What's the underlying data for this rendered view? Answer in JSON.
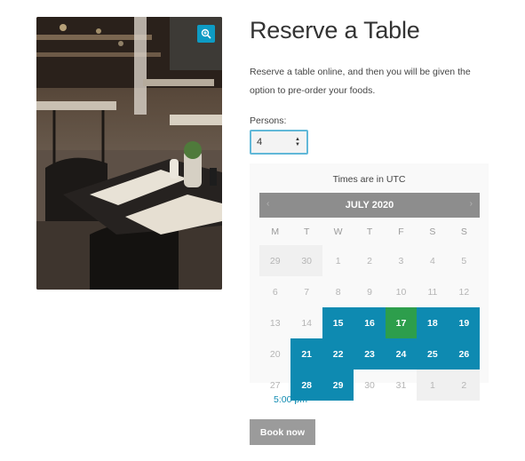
{
  "product": {
    "title": "Reserve a Table",
    "description": "Reserve a table online, and then you will be given the option to pre-order your foods.",
    "image_icon": "zoom-in-icon"
  },
  "form": {
    "persons_label": "Persons:",
    "persons_value": "4"
  },
  "calendar": {
    "timezone_note": "Times are in UTC",
    "month_label": "JULY 2020",
    "prev_symbol": "‹",
    "next_symbol": "›",
    "weekdays": [
      "M",
      "T",
      "W",
      "T",
      "F",
      "S",
      "S"
    ],
    "weeks": [
      [
        {
          "d": "29",
          "s": "muted"
        },
        {
          "d": "30",
          "s": "muted"
        },
        {
          "d": "1",
          "s": "past"
        },
        {
          "d": "2",
          "s": "past"
        },
        {
          "d": "3",
          "s": "past"
        },
        {
          "d": "4",
          "s": "past"
        },
        {
          "d": "5",
          "s": "past"
        }
      ],
      [
        {
          "d": "6",
          "s": "past"
        },
        {
          "d": "7",
          "s": "past"
        },
        {
          "d": "8",
          "s": "past"
        },
        {
          "d": "9",
          "s": "past"
        },
        {
          "d": "10",
          "s": "past"
        },
        {
          "d": "11",
          "s": "past"
        },
        {
          "d": "12",
          "s": "past"
        }
      ],
      [
        {
          "d": "13",
          "s": "past"
        },
        {
          "d": "14",
          "s": "past"
        },
        {
          "d": "15",
          "s": "avail"
        },
        {
          "d": "16",
          "s": "avail"
        },
        {
          "d": "17",
          "s": "selected"
        },
        {
          "d": "18",
          "s": "avail"
        },
        {
          "d": "19",
          "s": "avail"
        }
      ],
      [
        {
          "d": "20",
          "s": "past"
        },
        {
          "d": "21",
          "s": "avail"
        },
        {
          "d": "22",
          "s": "avail"
        },
        {
          "d": "23",
          "s": "avail"
        },
        {
          "d": "24",
          "s": "avail"
        },
        {
          "d": "25",
          "s": "avail"
        },
        {
          "d": "26",
          "s": "avail"
        }
      ],
      [
        {
          "d": "27",
          "s": "past"
        },
        {
          "d": "28",
          "s": "avail"
        },
        {
          "d": "29",
          "s": "avail"
        },
        {
          "d": "30",
          "s": "past"
        },
        {
          "d": "31",
          "s": "past"
        },
        {
          "d": "1",
          "s": "muted"
        },
        {
          "d": "2",
          "s": "muted"
        }
      ]
    ]
  },
  "time_slot": "5:00 pm",
  "book_button": "Book now",
  "colors": {
    "available": "#0e8ab1",
    "selected": "#2d9e4c",
    "header": "#8d8d8d",
    "button": "#9b9b9b"
  }
}
